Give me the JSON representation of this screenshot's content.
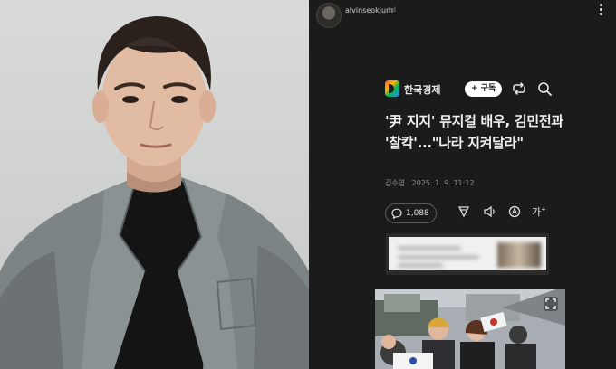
{
  "instagram": {
    "username": "alvinseokjum",
    "time": "1d"
  },
  "article": {
    "publisher": "한국경제",
    "subscribe_label": "+ 구독",
    "headline": "'尹 지지' 뮤지컬 배우, 김민전과 '찰칵'...\"나라 지켜달라\"",
    "author": "김수영",
    "date": "2025. 1. 9. 11:12",
    "comment_count": "1,088",
    "font_size_label": "가"
  },
  "colors": {
    "page_bg": "#1b1b1b",
    "headline": "#f0f0f0",
    "suit": "#7d8486"
  }
}
